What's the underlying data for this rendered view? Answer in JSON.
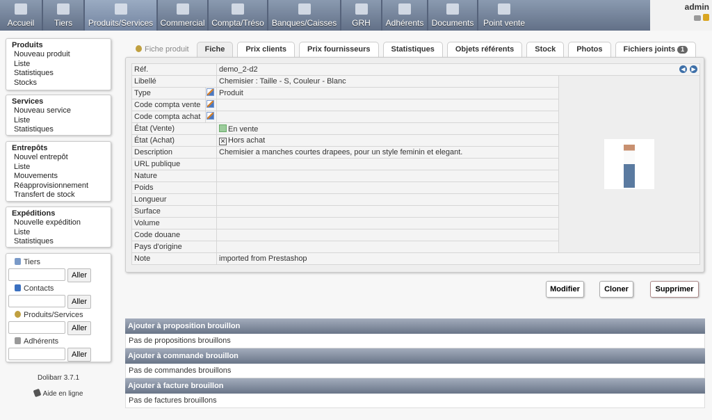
{
  "menu": [
    "Accueil",
    "Tiers",
    "Produits/Services",
    "Commercial",
    "Compta/Tréso",
    "Banques/Caisses",
    "GRH",
    "Adhérents",
    "Documents",
    "Point vente"
  ],
  "user": {
    "name": "admin"
  },
  "sidebar": {
    "produits": {
      "title": "Produits",
      "items": [
        "Nouveau produit",
        "Liste",
        "Statistiques",
        "Stocks"
      ]
    },
    "services": {
      "title": "Services",
      "items": [
        "Nouveau service",
        "Liste",
        "Statistiques"
      ]
    },
    "entrepots": {
      "title": "Entrepôts",
      "items": [
        "Nouvel entrepôt",
        "Liste",
        "Mouvements",
        "Réapprovisionnement",
        "Transfert de stock"
      ]
    },
    "expeditions": {
      "title": "Expéditions",
      "items": [
        "Nouvelle expédition",
        "Liste",
        "Statistiques"
      ]
    }
  },
  "search": {
    "tiers": "Tiers",
    "contacts": "Contacts",
    "produits": "Produits/Services",
    "adherents": "Adhérents",
    "go": "Aller"
  },
  "version": "Dolibarr 3.7.1",
  "help": "Aide en ligne",
  "tabs": {
    "title": "Fiche produit",
    "items": [
      "Fiche",
      "Prix clients",
      "Prix fournisseurs",
      "Statistiques",
      "Objets référents",
      "Stock",
      "Photos",
      "Fichiers joints"
    ],
    "files_count": "1"
  },
  "fields": {
    "ref": {
      "label": "Réf.",
      "value": "demo_2-d2"
    },
    "libelle": {
      "label": "Libellé",
      "value": "Chemisier : Taille - S, Couleur - Blanc"
    },
    "type": {
      "label": "Type",
      "value": "Produit"
    },
    "compta_vente": {
      "label": "Code compta vente",
      "value": ""
    },
    "compta_achat": {
      "label": "Code compta achat",
      "value": ""
    },
    "etat_vente": {
      "label": "État (Vente)",
      "value": "En vente"
    },
    "etat_achat": {
      "label": "État (Achat)",
      "value": "Hors achat"
    },
    "description": {
      "label": "Description",
      "value": "Chemisier a manches courtes drapees, pour un style feminin et elegant."
    },
    "url": {
      "label": "URL publique",
      "value": ""
    },
    "nature": {
      "label": "Nature",
      "value": ""
    },
    "poids": {
      "label": "Poids",
      "value": ""
    },
    "longueur": {
      "label": "Longueur",
      "value": ""
    },
    "surface": {
      "label": "Surface",
      "value": ""
    },
    "volume": {
      "label": "Volume",
      "value": ""
    },
    "douane": {
      "label": "Code douane",
      "value": ""
    },
    "pays": {
      "label": "Pays d'origine",
      "value": ""
    },
    "note": {
      "label": "Note",
      "value": "imported from Prestashop"
    }
  },
  "actions": {
    "modify": "Modifier",
    "clone": "Cloner",
    "delete": "Supprimer"
  },
  "sections": [
    {
      "title": "Ajouter à proposition brouillon",
      "empty": "Pas de propositions brouillons"
    },
    {
      "title": "Ajouter à commande brouillon",
      "empty": "Pas de commandes brouillons"
    },
    {
      "title": "Ajouter à facture brouillon",
      "empty": "Pas de factures brouillons"
    }
  ]
}
